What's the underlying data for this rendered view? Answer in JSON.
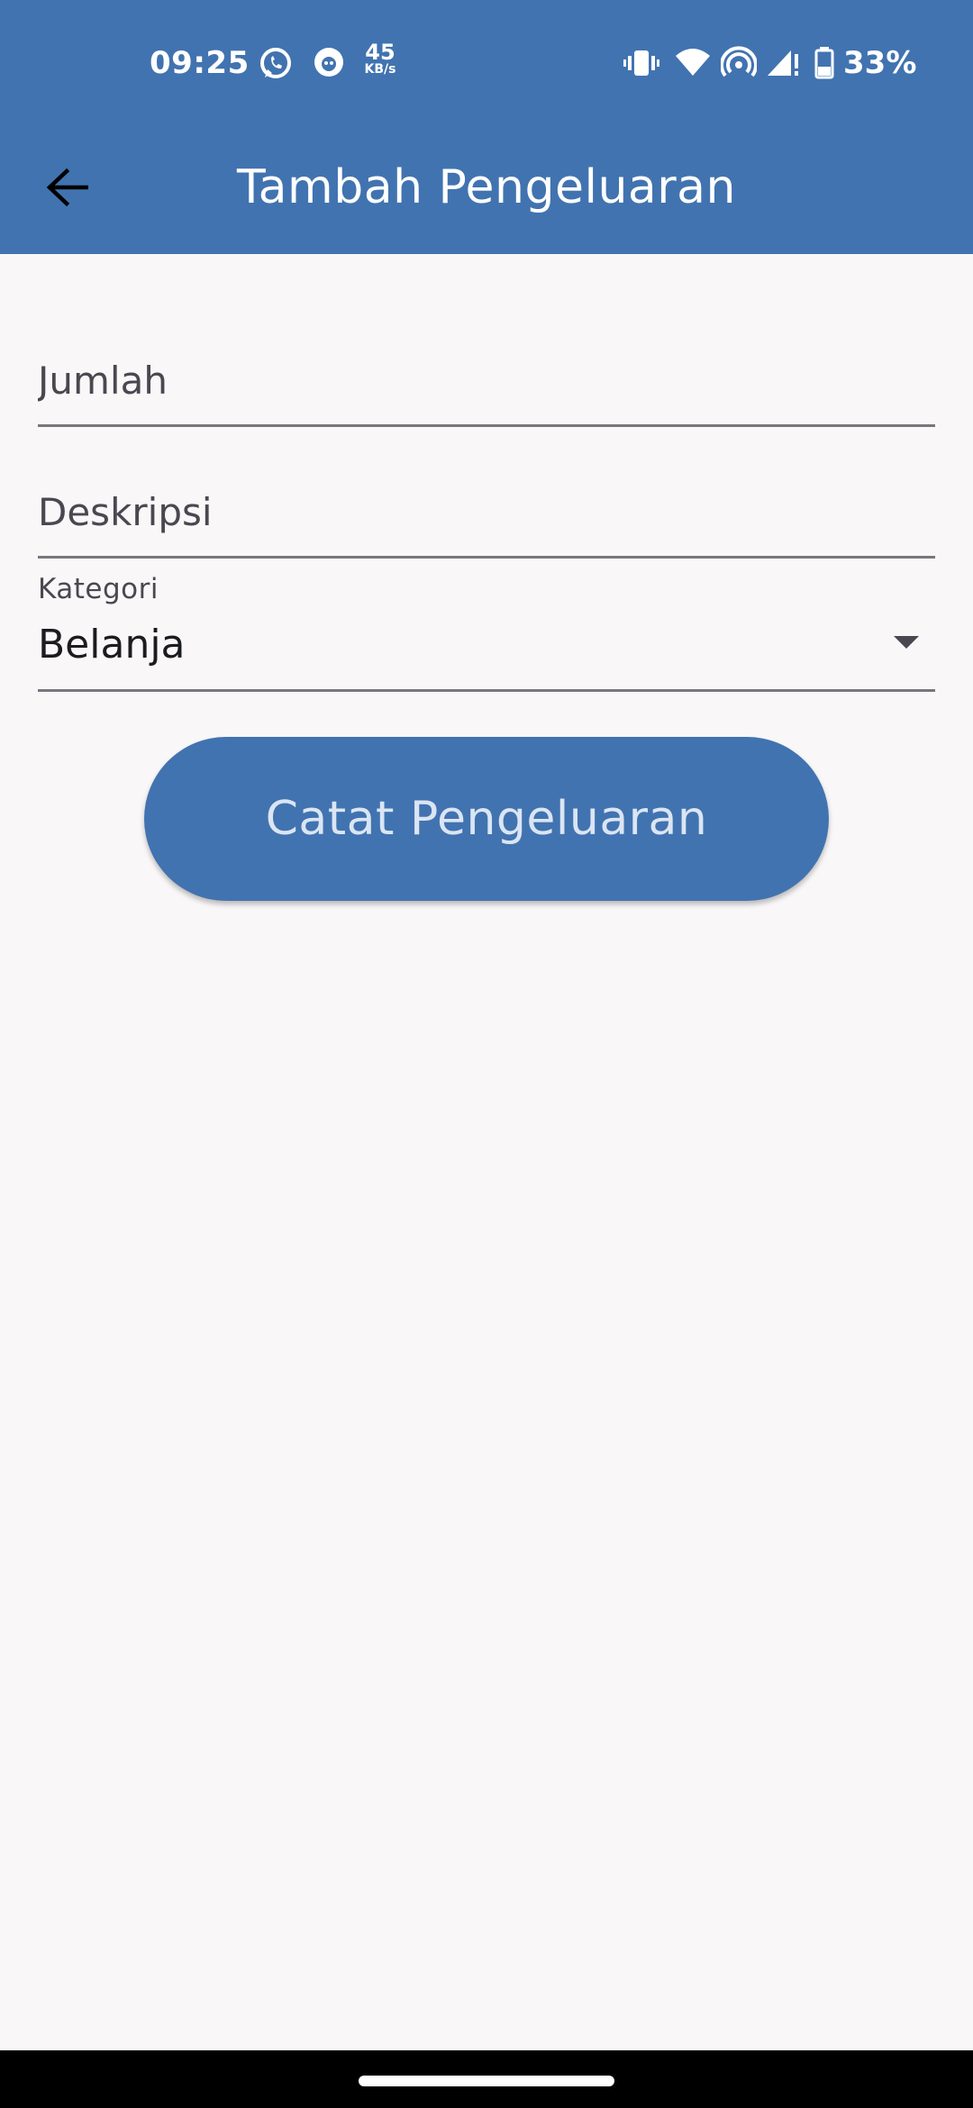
{
  "status_bar": {
    "time": "09:25",
    "net_speed_value": "45",
    "net_speed_unit": "KB/s",
    "battery_percent": "33%",
    "icons": [
      "whatsapp-icon",
      "notification-app-icon",
      "vibrate-icon",
      "wifi-icon",
      "hotspot-icon",
      "signal-icon",
      "battery-icon"
    ]
  },
  "app_bar": {
    "title": "Tambah Pengeluaran",
    "back_icon": "arrow-back-icon",
    "color": "#4173b0"
  },
  "form": {
    "amount_placeholder": "Jumlah",
    "description_placeholder": "Deskripsi",
    "category_label": "Kategori",
    "category_value": "Belanja",
    "submit_label": "Catat Pengeluaran"
  }
}
